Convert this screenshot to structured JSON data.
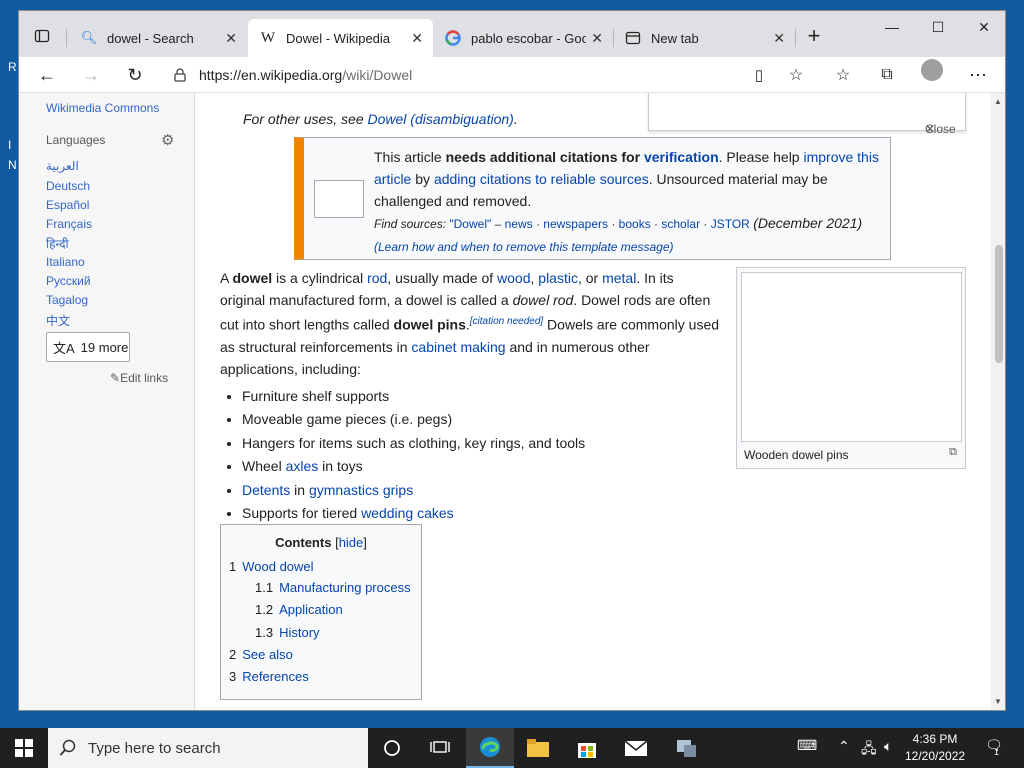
{
  "desktop": {
    "letters": [
      "R",
      "I",
      "N"
    ]
  },
  "browser": {
    "tabs": [
      {
        "title": "dowel - Search",
        "icon": "search-icon"
      },
      {
        "title": "Dowel - Wikipedia",
        "icon": "wikipedia-icon"
      },
      {
        "title": "pablo escobar - Goog",
        "icon": "google-icon"
      },
      {
        "title": "New tab",
        "icon": "newtab-icon"
      }
    ],
    "url_host": "https://en.wikipedia.org",
    "url_path": "/wiki/Dowel"
  },
  "sidebar": {
    "wikimedia_commons": "Wikimedia Commons",
    "languages_heading": "Languages",
    "languages": [
      "العربية",
      "Deutsch",
      "Español",
      "Français",
      "हिन्दी",
      "Italiano",
      "Русский",
      "Tagalog",
      "中文"
    ],
    "more_label": "19 more",
    "edit_links": "Edit links"
  },
  "article": {
    "hatnote_prefix": "For other uses, see ",
    "hatnote_link": "Dowel (disambiguation)",
    "hatnote_suffix": ".",
    "close_label": "Close",
    "ambox": {
      "t1": "This article ",
      "t2": "needs additional citations for ",
      "t3": "verification",
      "t4": ". Please help ",
      "t5": "improve this article",
      "t6": " by ",
      "t7": "adding citations to reliable sources",
      "t8": ". Unsourced material may be challenged and removed.",
      "find_sources": "Find sources:",
      "q": "\"Dowel\"",
      "dash": " – ",
      "news": "news",
      "newspapers": "newspapers",
      "books": "books",
      "scholar": "scholar",
      "jstor": "JSTOR",
      "date": "(December 2021)",
      "learn": "(Learn how and when to remove this template message)"
    },
    "p": {
      "a": "A ",
      "dowel": "dowel",
      "b": " is a cylindrical ",
      "rod": "rod",
      "c": ", usually made of ",
      "wood": "wood",
      "d": ", ",
      "plastic": "plastic",
      "e": ", or ",
      "metal": "metal",
      "f": ". In its original manufactured form, a dowel is called a ",
      "dowel_rod": "dowel rod",
      "g": ". Dowel rods are often cut into short lengths called ",
      "dowel_pins": "dowel pins",
      "h": ".",
      "citation_needed": "[citation needed]",
      "i": " Dowels are commonly used as structural reinforcements in ",
      "cabinet": "cabinet making",
      "j": " and in numerous other applications, including:"
    },
    "list": {
      "l1": "Furniture shelf supports",
      "l2": "Moveable game pieces (i.e. pegs)",
      "l3a": "Hangers for items such as clothing, key rings, and tools",
      "l4a": "Wheel ",
      "l4b": "axles",
      "l4c": " in toys",
      "l5a": "Detents",
      "l5b": " in ",
      "l5c": "gymnastics grips",
      "l6a": "Supports for tiered ",
      "l6b": "wedding cakes"
    },
    "thumb_caption": "Wooden dowel pins",
    "toc": {
      "title": "Contents",
      "hide": "hide",
      "items": [
        {
          "num": "1",
          "label": "Wood dowel"
        },
        {
          "num": "1.1",
          "label": "Manufacturing process"
        },
        {
          "num": "1.2",
          "label": "Application"
        },
        {
          "num": "1.3",
          "label": "History"
        },
        {
          "num": "2",
          "label": "See also"
        },
        {
          "num": "3",
          "label": "References"
        }
      ]
    }
  },
  "taskbar": {
    "search_placeholder": "Type here to search",
    "time": "4:36 PM",
    "date": "12/20/2022",
    "notification_count": "1"
  }
}
